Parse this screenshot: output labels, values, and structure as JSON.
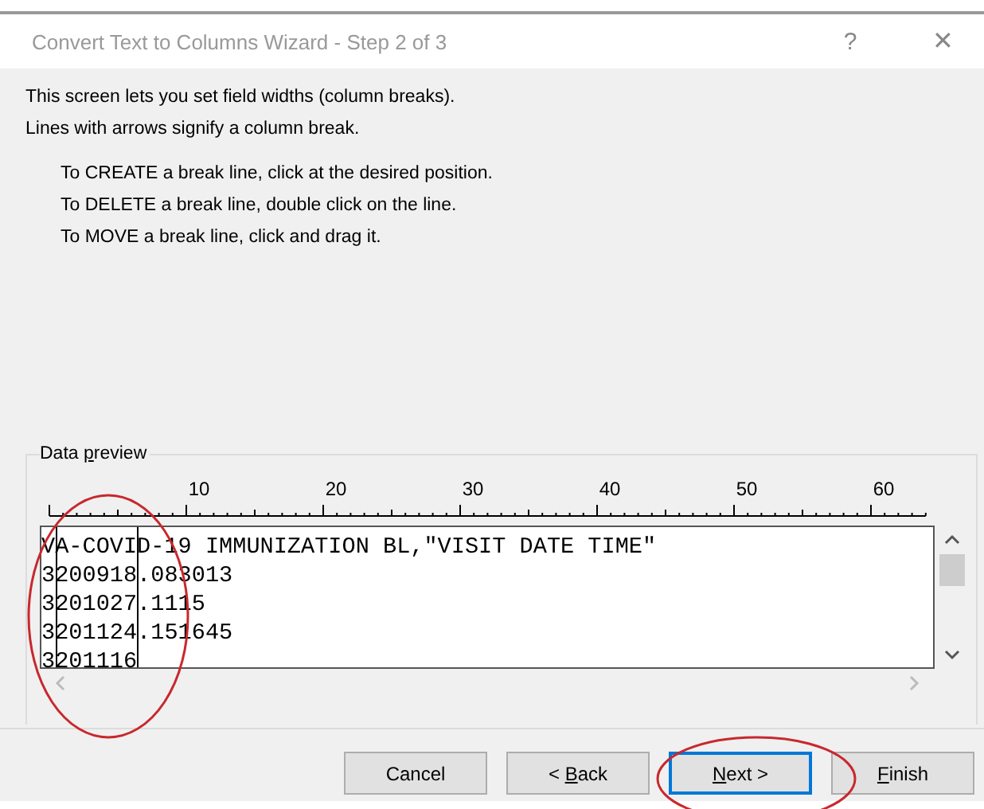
{
  "window": {
    "title": "Convert Text to Columns Wizard - Step 2 of 3",
    "help": "?",
    "close": "✕"
  },
  "intro": [
    "This screen lets you set field widths (column breaks).",
    "Lines with arrows signify a column break."
  ],
  "instructions": [
    "To CREATE a break line, click at the desired position.",
    "To DELETE a break line, double click on the line.",
    "To MOVE a break line, click and drag it."
  ],
  "preview": {
    "label": {
      "pre": "Data ",
      "key": "p",
      "post": "review"
    },
    "ruler_labels": [
      "10",
      "20",
      "30",
      "40",
      "50",
      "60"
    ],
    "lines": [
      "VA-COVID-19 IMMUNIZATION BL,\"VISIT DATE TIME\"",
      "3200918.083013",
      "3201027.1115",
      "3201124.151645",
      "3201116"
    ]
  },
  "buttons": [
    {
      "label": {
        "pre": "Cancel"
      },
      "focused": false
    },
    {
      "label": {
        "pre": "< ",
        "key": "B",
        "post": "ack"
      },
      "focused": false
    },
    {
      "label": {
        "key": "N",
        "post": "ext >"
      },
      "focused": true
    },
    {
      "label": {
        "key": "F",
        "post": "inish"
      },
      "focused": false
    }
  ]
}
